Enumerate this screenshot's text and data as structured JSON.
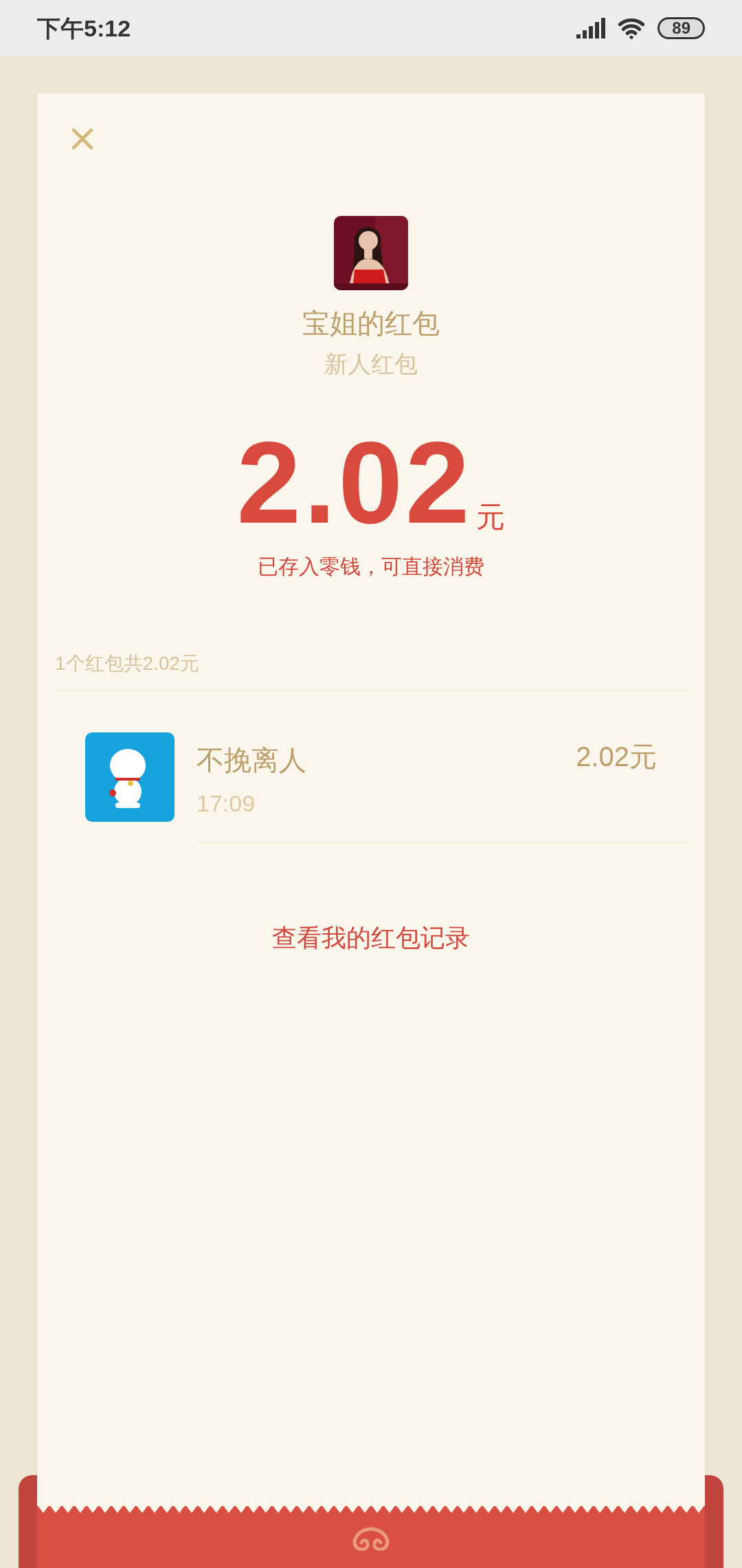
{
  "status_bar": {
    "time": "下午5:12",
    "battery": "89"
  },
  "packet": {
    "sender_title": "宝姐的红包",
    "subtitle": "新人红包",
    "amount": "2.02",
    "unit": "元",
    "note": "已存入零钱，可直接消费"
  },
  "summary": "1个红包共2.02元",
  "records": [
    {
      "name": "不挽离人",
      "time": "17:09",
      "amount": "2.02元"
    }
  ],
  "link": "查看我的红包记录"
}
